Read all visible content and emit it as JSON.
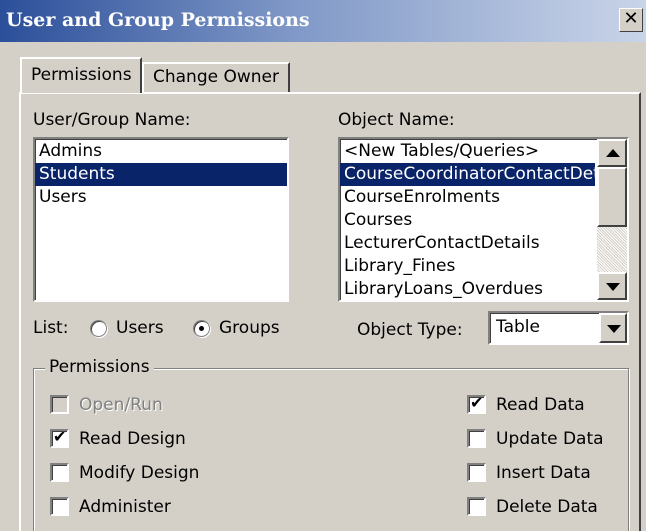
{
  "window": {
    "title": "User and Group Permissions",
    "close_glyph": "✕"
  },
  "tabs": [
    {
      "label": "Permissions",
      "active": true
    },
    {
      "label": "Change Owner",
      "active": false
    }
  ],
  "user_group": {
    "label": "User/Group Name:",
    "items": [
      "Admins",
      "Students",
      "Users"
    ],
    "selected": "Students"
  },
  "objects": {
    "label": "Object Name:",
    "items": [
      "<New Tables/Queries>",
      "CourseCoordinatorContactDetails",
      "CourseEnrolments",
      "Courses",
      "LecturerContactDetails",
      "Library_Fines",
      "LibraryLoans_Overdues"
    ],
    "selected": "CourseCoordinatorContactDetails"
  },
  "list_filter": {
    "label": "List:",
    "options": [
      "Users",
      "Groups"
    ],
    "selected": "Groups"
  },
  "object_type": {
    "label": "Object Type:",
    "value": "Table"
  },
  "permissions": {
    "legend": "Permissions",
    "left": [
      {
        "label": "Open/Run",
        "checked": false,
        "enabled": false
      },
      {
        "label": "Read Design",
        "checked": true,
        "enabled": true
      },
      {
        "label": "Modify Design",
        "checked": false,
        "enabled": true
      },
      {
        "label": "Administer",
        "checked": false,
        "enabled": true
      }
    ],
    "right": [
      {
        "label": "Read Data",
        "checked": true,
        "enabled": true
      },
      {
        "label": "Update Data",
        "checked": false,
        "enabled": true
      },
      {
        "label": "Insert Data",
        "checked": false,
        "enabled": true
      },
      {
        "label": "Delete Data",
        "checked": false,
        "enabled": true
      }
    ]
  },
  "icons": {
    "close": "close-icon",
    "scroll_up": "chevron-up-icon",
    "scroll_down": "chevron-down-icon",
    "dropdown": "chevron-down-icon",
    "check": "checkmark-icon"
  },
  "colors": {
    "selection": "#0a246a",
    "face": "#d4d0c8",
    "title_start": "#2c4f9a",
    "title_end": "#c9d4e8"
  }
}
